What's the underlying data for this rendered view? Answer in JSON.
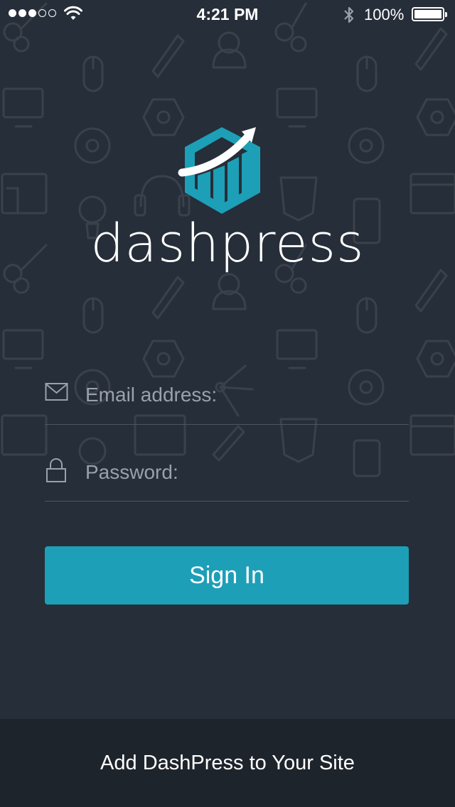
{
  "status_bar": {
    "time": "4:21 PM",
    "battery_percent": "100%",
    "signal_bars_filled": 3,
    "signal_bars_total": 5
  },
  "brand": {
    "name": "dashpress",
    "accent_color": "#1d9fb7",
    "background_color": "#262e39"
  },
  "login": {
    "email_placeholder": "Email address:",
    "password_placeholder": "Password:",
    "sign_in_label": "Sign In"
  },
  "footer": {
    "link_label": "Add DashPress to Your Site"
  },
  "icons": [
    "envelope-icon",
    "lock-icon",
    "wifi-icon",
    "bluetooth-icon",
    "battery-icon"
  ]
}
